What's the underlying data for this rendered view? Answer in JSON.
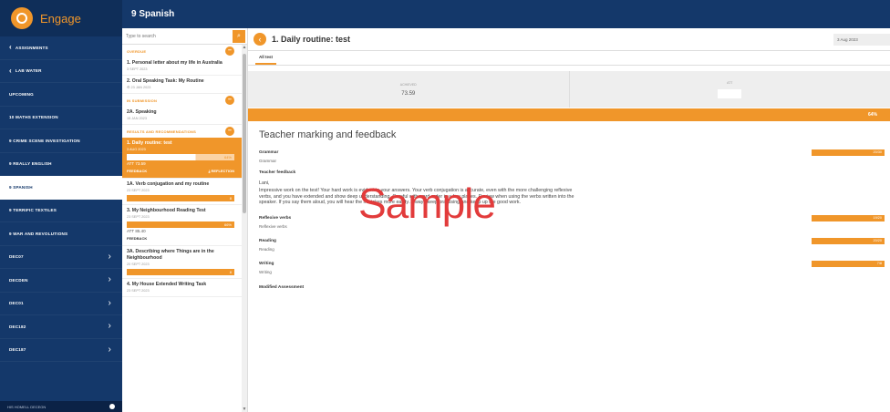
{
  "app": {
    "name": "Engage",
    "header_title": "9 Spanish"
  },
  "sidebar": {
    "items": [
      {
        "label": "ASSIGNMENTS",
        "back": "‹",
        "chevron": "",
        "active": false
      },
      {
        "label": "LAB WATER",
        "back": "‹",
        "chevron": "",
        "active": false
      },
      {
        "label": "UPCOMING",
        "back": "",
        "chevron": "",
        "active": false
      },
      {
        "label": "10 MATHS EXTENSION",
        "back": "",
        "chevron": "",
        "active": false
      },
      {
        "label": "9 CRIME SCENE INVESTIGATION",
        "back": "",
        "chevron": "",
        "active": false
      },
      {
        "label": "9 REALLY ENGLISH",
        "back": "",
        "chevron": "",
        "active": false
      },
      {
        "label": "9 SPANISH",
        "back": "",
        "chevron": "",
        "active": true
      },
      {
        "label": "9 TERRIFIC TEXTILES",
        "back": "",
        "chevron": "",
        "active": false
      },
      {
        "label": "9 WAR AND REVOLUTIONS",
        "back": "",
        "chevron": "",
        "active": false
      },
      {
        "label": "DEC07",
        "back": "",
        "chevron": "›",
        "active": false
      },
      {
        "label": "DECDEN",
        "back": "",
        "chevron": "›",
        "active": false
      },
      {
        "label": "DEC01",
        "back": "",
        "chevron": "›",
        "active": false
      },
      {
        "label": "DEC182",
        "back": "",
        "chevron": "›",
        "active": false
      },
      {
        "label": "DEC187",
        "back": "",
        "chevron": "›",
        "active": false
      }
    ],
    "footer_label": "HIS HOMELL DECEGN"
  },
  "task_list": {
    "search_placeholder": "Type to search",
    "groups": [
      {
        "heading": "OVERDUE",
        "toggle": "–",
        "tasks": [
          {
            "title": "1. Personal letter about my life in Australia",
            "date": "3 SEPT 2023",
            "bar": false,
            "active": false
          },
          {
            "title": "2. Oral Speaking Task: My Routine",
            "date": "⚙ 23 JAN 2023",
            "bar": false,
            "active": false
          }
        ]
      },
      {
        "heading": "IN SUBMISSION",
        "toggle": "–",
        "tasks": [
          {
            "title": "2A. Speaking",
            "date": "15 JAN 2023",
            "bar": false,
            "active": false
          }
        ]
      },
      {
        "heading": "RESULTS AND RECOMMENDATIONS",
        "toggle": "–",
        "tasks": [
          {
            "title": "1. Daily routine: test",
            "date": "3 AUG 2023",
            "bar": true,
            "progress": 0.64,
            "percent": "64%",
            "meta": "ATT  73.59",
            "foot_left": "FEEDBACK",
            "foot_right": "⤓ REFLECTION",
            "active": true
          },
          {
            "title": "1A. Verb conjugation and my routine",
            "date": "23 SEPT 2023",
            "bar": true,
            "progress": 1,
            "percent": "8",
            "active": false
          },
          {
            "title": "3. My Neighbourhood Reading Test",
            "date": "23 SEPT 2023",
            "bar": true,
            "progress": 1,
            "percent": "66%",
            "meta": "ATT  85.40",
            "foot_left": "FEEDBACK",
            "active": false
          },
          {
            "title": "3A. Describing where Things are in the Neighbourhood",
            "date": "20 SEPT 2023",
            "bar": true,
            "progress": 1,
            "percent": "8",
            "active": false
          },
          {
            "title": "4. My House Extended Writing Task",
            "date": "23 SEPT 2023",
            "bar": false,
            "active": false
          }
        ]
      }
    ]
  },
  "detail": {
    "title": "1. Daily routine: test",
    "date": "3 Aug 2023",
    "tab": "All test",
    "stats": [
      {
        "label": "ACHIEVED",
        "value": "73.59"
      },
      {
        "label": "ATT",
        "value": ""
      }
    ],
    "overall_percent": "64%",
    "overall_progress": 0.64,
    "feedback_heading": "Teacher marking and feedback",
    "criteria_top": [
      {
        "label": "Grammar",
        "sub": "Grammar",
        "value": "20/30"
      }
    ],
    "teacher_feedback": {
      "label": "Teacher feedback",
      "greeting": "Lani,",
      "body": "Impressive work on the test! Your hard work is evident in your answers. Your verb conjugation is accurate, even with the more challenging reflexive verbs, and you have extended and show deep understanding. Careful with word order in a few places. Review when using the verbs written into the speaker. If you say them aloud, you will hear the mistakes more easily. Always keep practising and keep up the good work."
    },
    "criteria_bottom": [
      {
        "label": "Reflexive verbs",
        "sub": "Reflexive verbs",
        "value": "19/20"
      },
      {
        "label": "Reading",
        "sub": "Reading",
        "value": "20/20"
      },
      {
        "label": "Writing",
        "sub": "Writing",
        "value": "7/8"
      }
    ],
    "modified_label": "Modified Assessment"
  },
  "watermark": "Sample",
  "colors": {
    "navy": "#14386a",
    "accent": "#f0962a"
  }
}
